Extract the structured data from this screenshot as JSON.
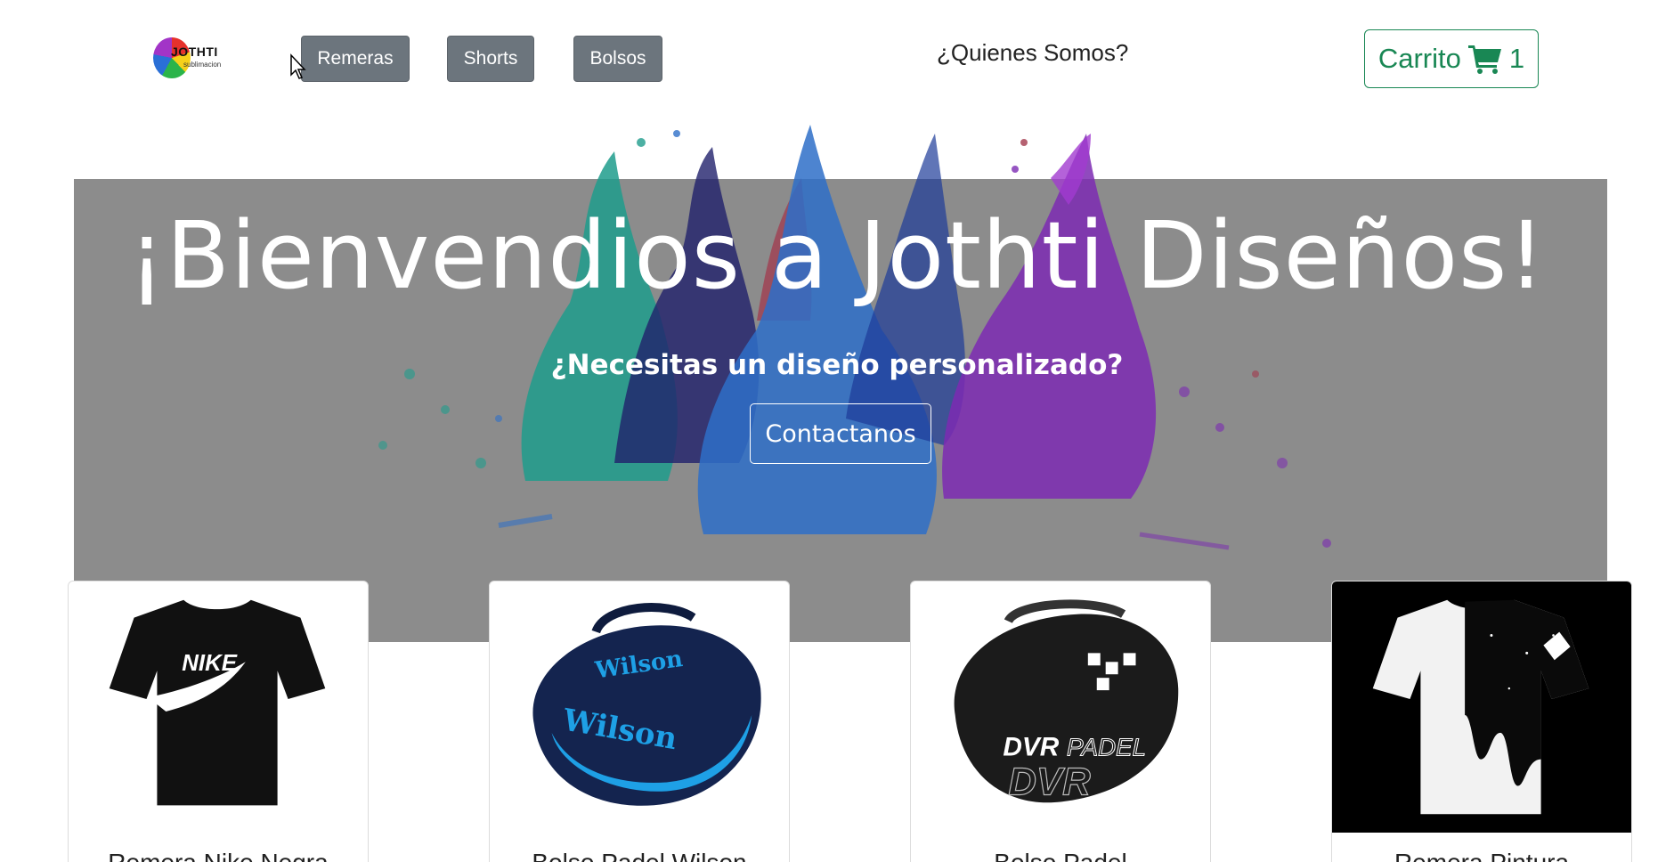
{
  "navbar": {
    "logo_text": "JOTHTI",
    "logo_subtext": "sublimacion",
    "buttons": [
      {
        "label": "Remeras"
      },
      {
        "label": "Shorts"
      },
      {
        "label": "Bolsos"
      }
    ],
    "about_link": "¿Quienes Somos?",
    "cart": {
      "label": "Carrito",
      "icon": "cart-icon",
      "count": "1"
    }
  },
  "hero": {
    "title": "¡Bienvendios a Jothti Diseños!",
    "subtitle": "¿Necesitas un diseño personalizado?",
    "button": "Contactanos"
  },
  "products": [
    {
      "name": "Remera Nike Negra",
      "image": "black-nike-tshirt"
    },
    {
      "name": "Bolso Padel Wilson",
      "image": "blue-wilson-padel-bag"
    },
    {
      "name": "Bolso Padel",
      "image": "black-dvr-padel-bag"
    },
    {
      "name": "Remera Pintura",
      "image": "paint-drip-tshirt"
    }
  ],
  "colors": {
    "nav_button": "#6c757d",
    "cart_green": "#198754",
    "hero_overlay": "#787878"
  }
}
